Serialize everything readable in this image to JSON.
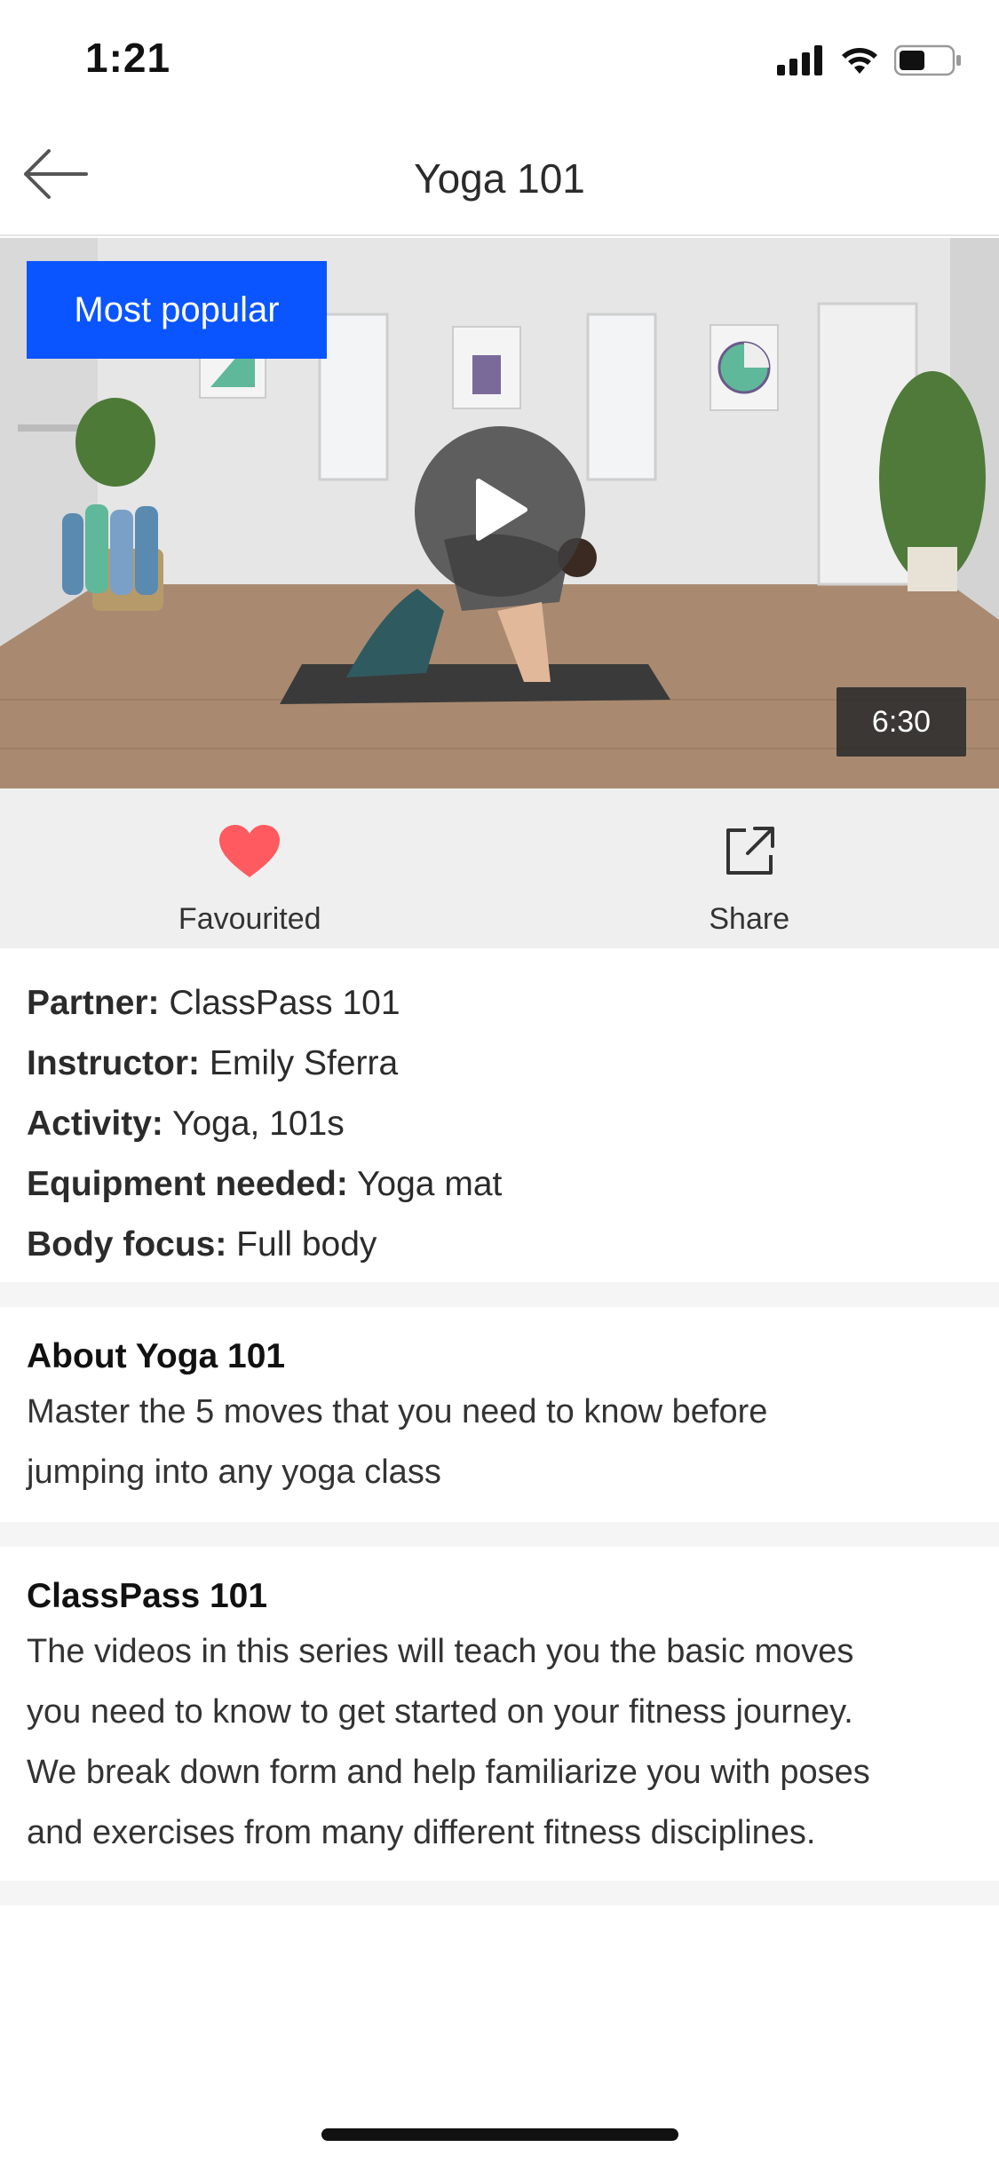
{
  "status_bar": {
    "time": "1:21",
    "icons": [
      "signal-icon",
      "wifi-icon",
      "battery-icon"
    ]
  },
  "nav": {
    "title": "Yoga 101",
    "back_icon": "back-arrow-icon"
  },
  "video": {
    "badge": "Most popular",
    "duration": "6:30",
    "play_icon": "play-icon",
    "badge_color": "#0a55ff"
  },
  "actions": [
    {
      "label": "Favourited",
      "icon": "heart-icon",
      "color": "#ff5a5f"
    },
    {
      "label": "Share",
      "icon": "share-icon"
    }
  ],
  "details": [
    {
      "key": "Partner:",
      "value": " ClassPass 101"
    },
    {
      "key": "Instructor:",
      "value": " Emily Sferra"
    },
    {
      "key": "Activity:",
      "value": " Yoga, 101s"
    },
    {
      "key": "Equipment needed:",
      "value": " Yoga mat"
    },
    {
      "key": "Body focus:",
      "value": " Full body"
    }
  ],
  "about": {
    "title": "About Yoga 101",
    "body_lines": [
      "Master the 5 moves that you need to know before",
      "jumping into any yoga class"
    ]
  },
  "series": {
    "title": "ClassPass 101",
    "body_lines": [
      "The videos in this series will teach you the basic moves",
      "you need to know to get started on your fitness journey.",
      "We break down form and help familiarize you with poses",
      "and exercises from many different fitness disciplines."
    ]
  }
}
